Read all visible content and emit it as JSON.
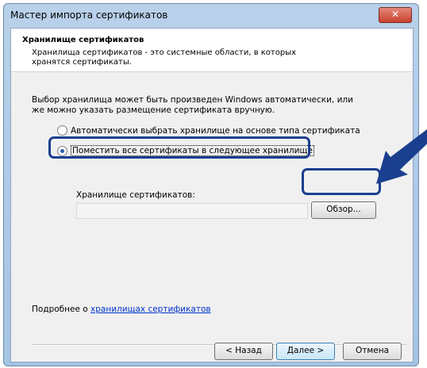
{
  "window": {
    "title": "Мастер импорта сертификатов",
    "close_glyph": "✕"
  },
  "header": {
    "title": "Хранилище сертификатов",
    "subtitle": "Хранилища сертификатов - это системные области, в которых хранятся сертификаты."
  },
  "body": {
    "description": "Выбор хранилища может быть произведен Windows автоматически, или же можно указать размещение сертификата вручную.",
    "radio_auto_label": "Автоматически выбрать хранилище на основе типа сертификата",
    "radio_manual_label": "Поместить все сертификаты в следующее хранилище",
    "store_label": "Хранилище сертификатов:",
    "store_value": "",
    "browse_label": "Обзор...",
    "more_prefix": "Подробнее о ",
    "more_link": "хранилищах сертификатов"
  },
  "footer": {
    "back_label": "< Назад",
    "next_label": "Далее >",
    "cancel_label": "Отмена"
  },
  "colors": {
    "highlight": "#1b3f8f",
    "link": "#0033cc"
  }
}
